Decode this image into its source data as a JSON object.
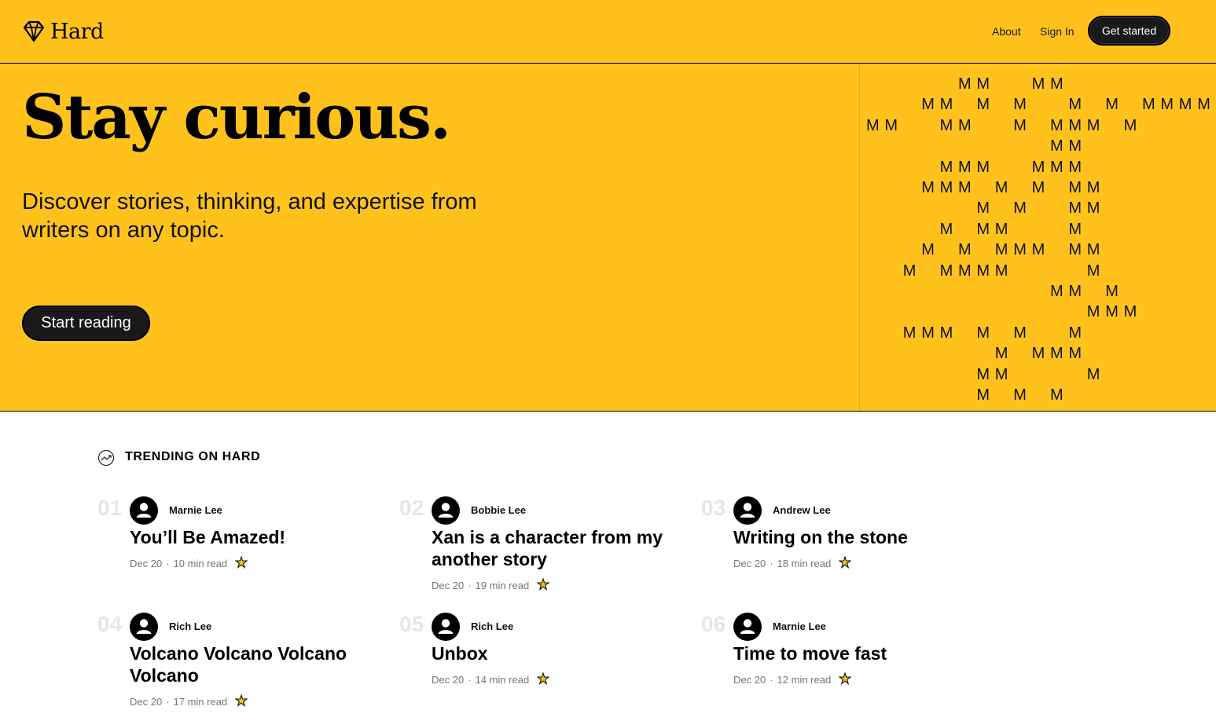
{
  "header": {
    "brand": "Hard",
    "nav": {
      "about": "About",
      "sign_in": "Sign In",
      "get_started": "Get started"
    }
  },
  "hero": {
    "title": "Stay curious.",
    "subtitle": "Discover stories, thinking, and expertise from writers on any topic.",
    "cta": "Start reading",
    "background_color": "#FFC21C",
    "m_art_rows": [
      "     MM  MM",
      "   MM M M  M M MMMM",
      "MM  MM  M MMM M",
      "          MM",
      "    MMM  MMM",
      "   MMM M M MM",
      "      M M  MM",
      "    M MM   M",
      "   M M MMM MM",
      "  M MMMM    M",
      "          MM M",
      "            MMM",
      "  MMM M M  M",
      "       M MMM",
      "      MM    M",
      "      M M M"
    ]
  },
  "trending": {
    "heading": "TRENDING ON HARD",
    "items": [
      {
        "num": "01",
        "author": "Marnie Lee",
        "title": "You’ll Be Amazed!",
        "date": "Dec 20",
        "read": "10 min read"
      },
      {
        "num": "02",
        "author": "Bobbie Lee",
        "title": "Xan is a character from my another story",
        "date": "Dec 20",
        "read": "19 min read"
      },
      {
        "num": "03",
        "author": "Andrew Lee",
        "title": "Writing on the stone",
        "date": "Dec 20",
        "read": "18 min read"
      },
      {
        "num": "04",
        "author": "Rich Lee",
        "title": "Volcano Volcano Volcano Volcano",
        "date": "Dec 20",
        "read": "17 min read"
      },
      {
        "num": "05",
        "author": "Rich Lee",
        "title": "Unbox",
        "date": "Dec 20",
        "read": "14 min read"
      },
      {
        "num": "06",
        "author": "Marnie Lee",
        "title": "Time to move fast",
        "date": "Dec 20",
        "read": "12 min read"
      }
    ]
  }
}
